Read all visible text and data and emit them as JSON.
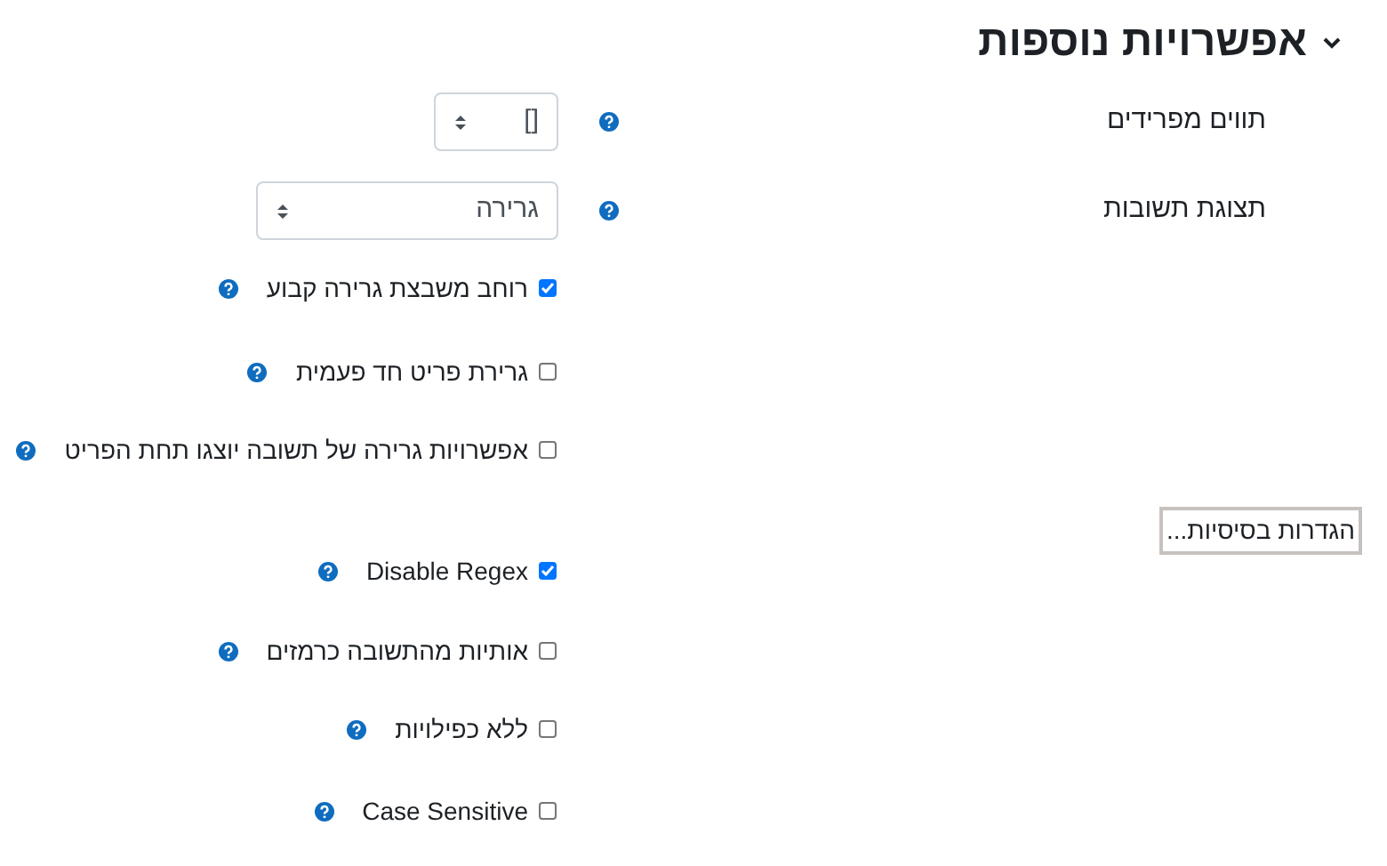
{
  "section": {
    "title": "אפשרויות נוספות",
    "expanded": true
  },
  "selects": [
    {
      "label": "תווים מפרידים",
      "value": "[]"
    },
    {
      "label": "תצוגת תשובות",
      "value": "גרירה"
    }
  ],
  "checkboxes": [
    {
      "label": "רוחב משבצת גרירה קבוע",
      "checked": true
    },
    {
      "label": "גרירת פריט חד פעמית",
      "checked": false
    },
    {
      "label": "אפשרויות גרירה של תשובה יוצגו תחת הפריט",
      "checked": false
    },
    {
      "label": "Disable Regex",
      "checked": true
    },
    {
      "label": "אותיות מהתשובה כרמזים",
      "checked": false
    },
    {
      "label": "ללא כפילויות",
      "checked": false
    },
    {
      "label": "Case Sensitive",
      "checked": false
    }
  ],
  "tooltip": {
    "text": "הגדרות בסיסיות..."
  }
}
